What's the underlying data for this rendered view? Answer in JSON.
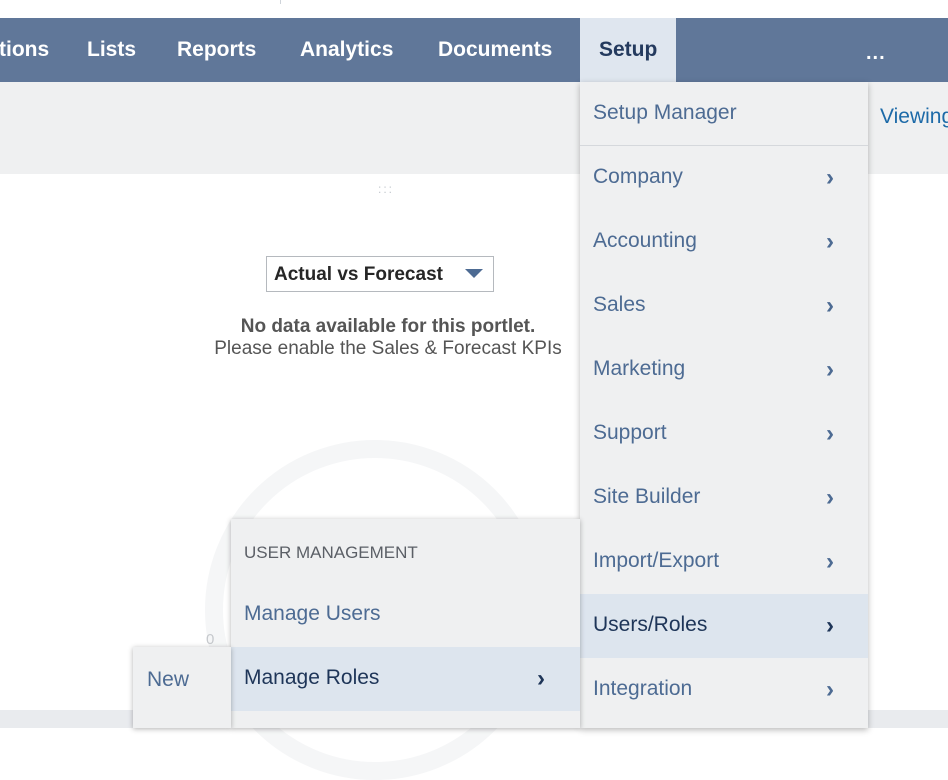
{
  "navbar": {
    "items": [
      "tions",
      "Lists",
      "Reports",
      "Analytics",
      "Documents",
      "Setup"
    ],
    "active": "Setup",
    "more_label": "..."
  },
  "header": {
    "viewing_label": "Viewing"
  },
  "portlet": {
    "drag_handle": ":::",
    "select_value": "Actual vs Forecast",
    "no_data_title": "No data available for this portlet.",
    "no_data_message": "Please enable the Sales & Forecast KPIs",
    "gauge_zero": "0"
  },
  "setup_menu": {
    "items": [
      {
        "label": "Setup Manager",
        "has_submenu": false
      },
      {
        "label": "Company",
        "has_submenu": true
      },
      {
        "label": "Accounting",
        "has_submenu": true
      },
      {
        "label": "Sales",
        "has_submenu": true
      },
      {
        "label": "Marketing",
        "has_submenu": true
      },
      {
        "label": "Support",
        "has_submenu": true
      },
      {
        "label": "Site Builder",
        "has_submenu": true
      },
      {
        "label": "Import/Export",
        "has_submenu": true
      },
      {
        "label": "Users/Roles",
        "has_submenu": true,
        "selected": true
      },
      {
        "label": "Integration",
        "has_submenu": true
      }
    ]
  },
  "users_roles_menu": {
    "heading": "USER MANAGEMENT",
    "items": [
      {
        "label": "Manage Users",
        "has_submenu": false
      },
      {
        "label": "Manage Roles",
        "has_submenu": true,
        "selected": true
      }
    ]
  },
  "manage_roles_menu": {
    "items": [
      {
        "label": "New"
      }
    ]
  },
  "colors": {
    "nav_background": "#607799",
    "menu_background": "#eff0f1",
    "menu_link": "#4d6b93",
    "menu_selected": "#dde5ee"
  },
  "chevron_glyph": "›"
}
